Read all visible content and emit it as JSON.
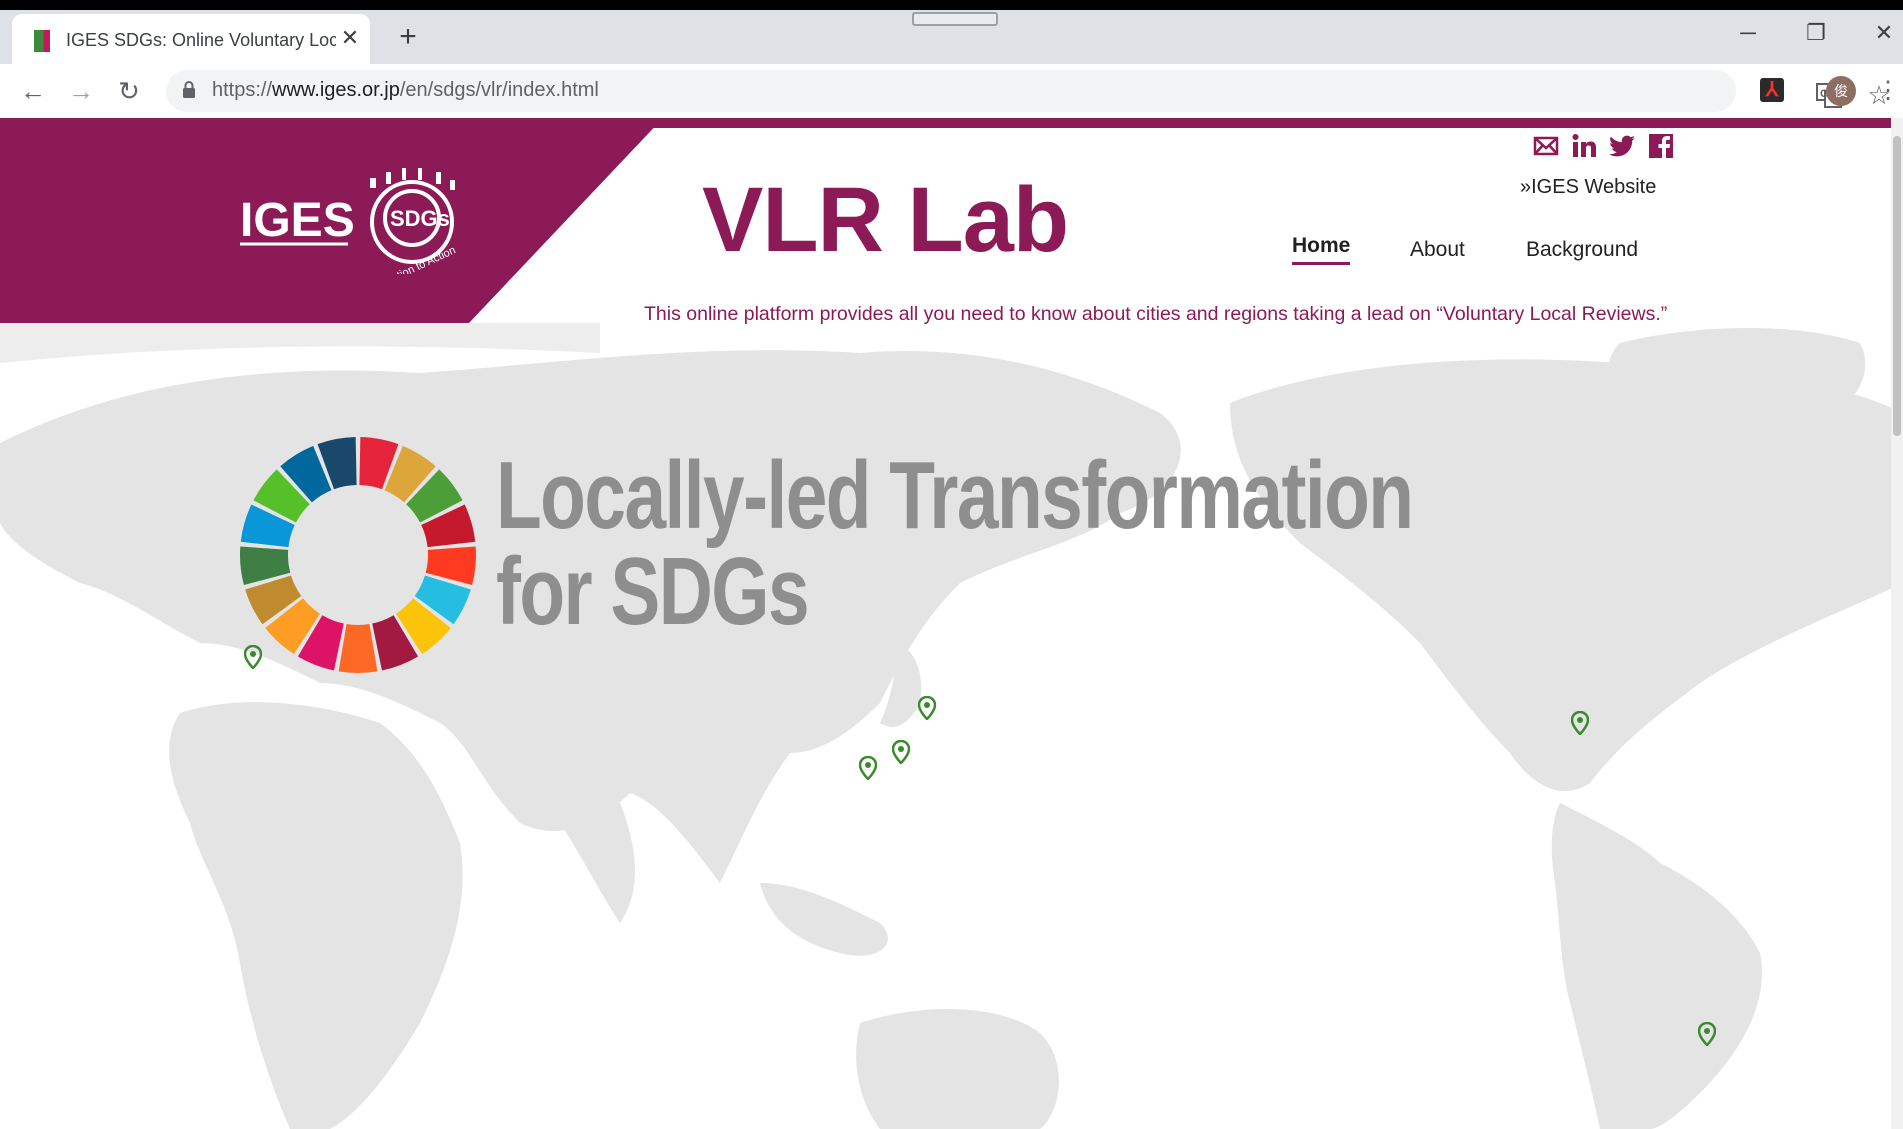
{
  "browser": {
    "tab_title": "IGES SDGs: Online Voluntary Loc",
    "tab_close": "✕",
    "new_tab": "+",
    "url_scheme": "https://",
    "url_host": "www.iges.or.jp",
    "url_path": "/en/sdgs/vlr/index.html",
    "profile_initial": "俊",
    "win_minimize": "─",
    "win_restore": "❐",
    "win_close": "✕",
    "back": "←",
    "forward": "→",
    "reload": "↻",
    "star": "☆",
    "menu": "⋮"
  },
  "header": {
    "logo_text": "IGES",
    "logo_badge": "SDGs",
    "logo_ring_text": "Aspiration to Action",
    "site_title": "VLR Lab",
    "iges_link": "»IGES Website",
    "tagline": "This online platform provides all you need to know about cities and regions taking a lead on “Voluntary Local Reviews.”"
  },
  "social": [
    {
      "name": "email-icon",
      "glyph": "✉"
    },
    {
      "name": "linkedin-icon",
      "glyph": "in"
    },
    {
      "name": "twitter-icon",
      "glyph": "🐦"
    },
    {
      "name": "facebook-icon",
      "glyph": "f"
    }
  ],
  "nav": {
    "home": "Home",
    "about": "About",
    "background": "Background"
  },
  "hero": {
    "line1": "Locally-led Transformation",
    "line2": "for SDGs"
  },
  "colors": {
    "brand": "#8c1a57",
    "pin": "#3a8a2e",
    "map_land": "#e4e4e4",
    "headline": "#8e8e8e"
  },
  "map_pins": [
    "europe-pin",
    "japan-north-pin",
    "japan-central-pin",
    "japan-west-pin",
    "north-america-pin",
    "south-america-pin"
  ],
  "sdg_colors": [
    "#e5243b",
    "#dda63a",
    "#4c9f38",
    "#c5192d",
    "#ff3a21",
    "#26bde2",
    "#fcc30b",
    "#a21942",
    "#fd6925",
    "#dd1367",
    "#fd9d24",
    "#bf8b2e",
    "#3f7e44",
    "#0a97d9",
    "#56c02b",
    "#00689d",
    "#19486a"
  ]
}
